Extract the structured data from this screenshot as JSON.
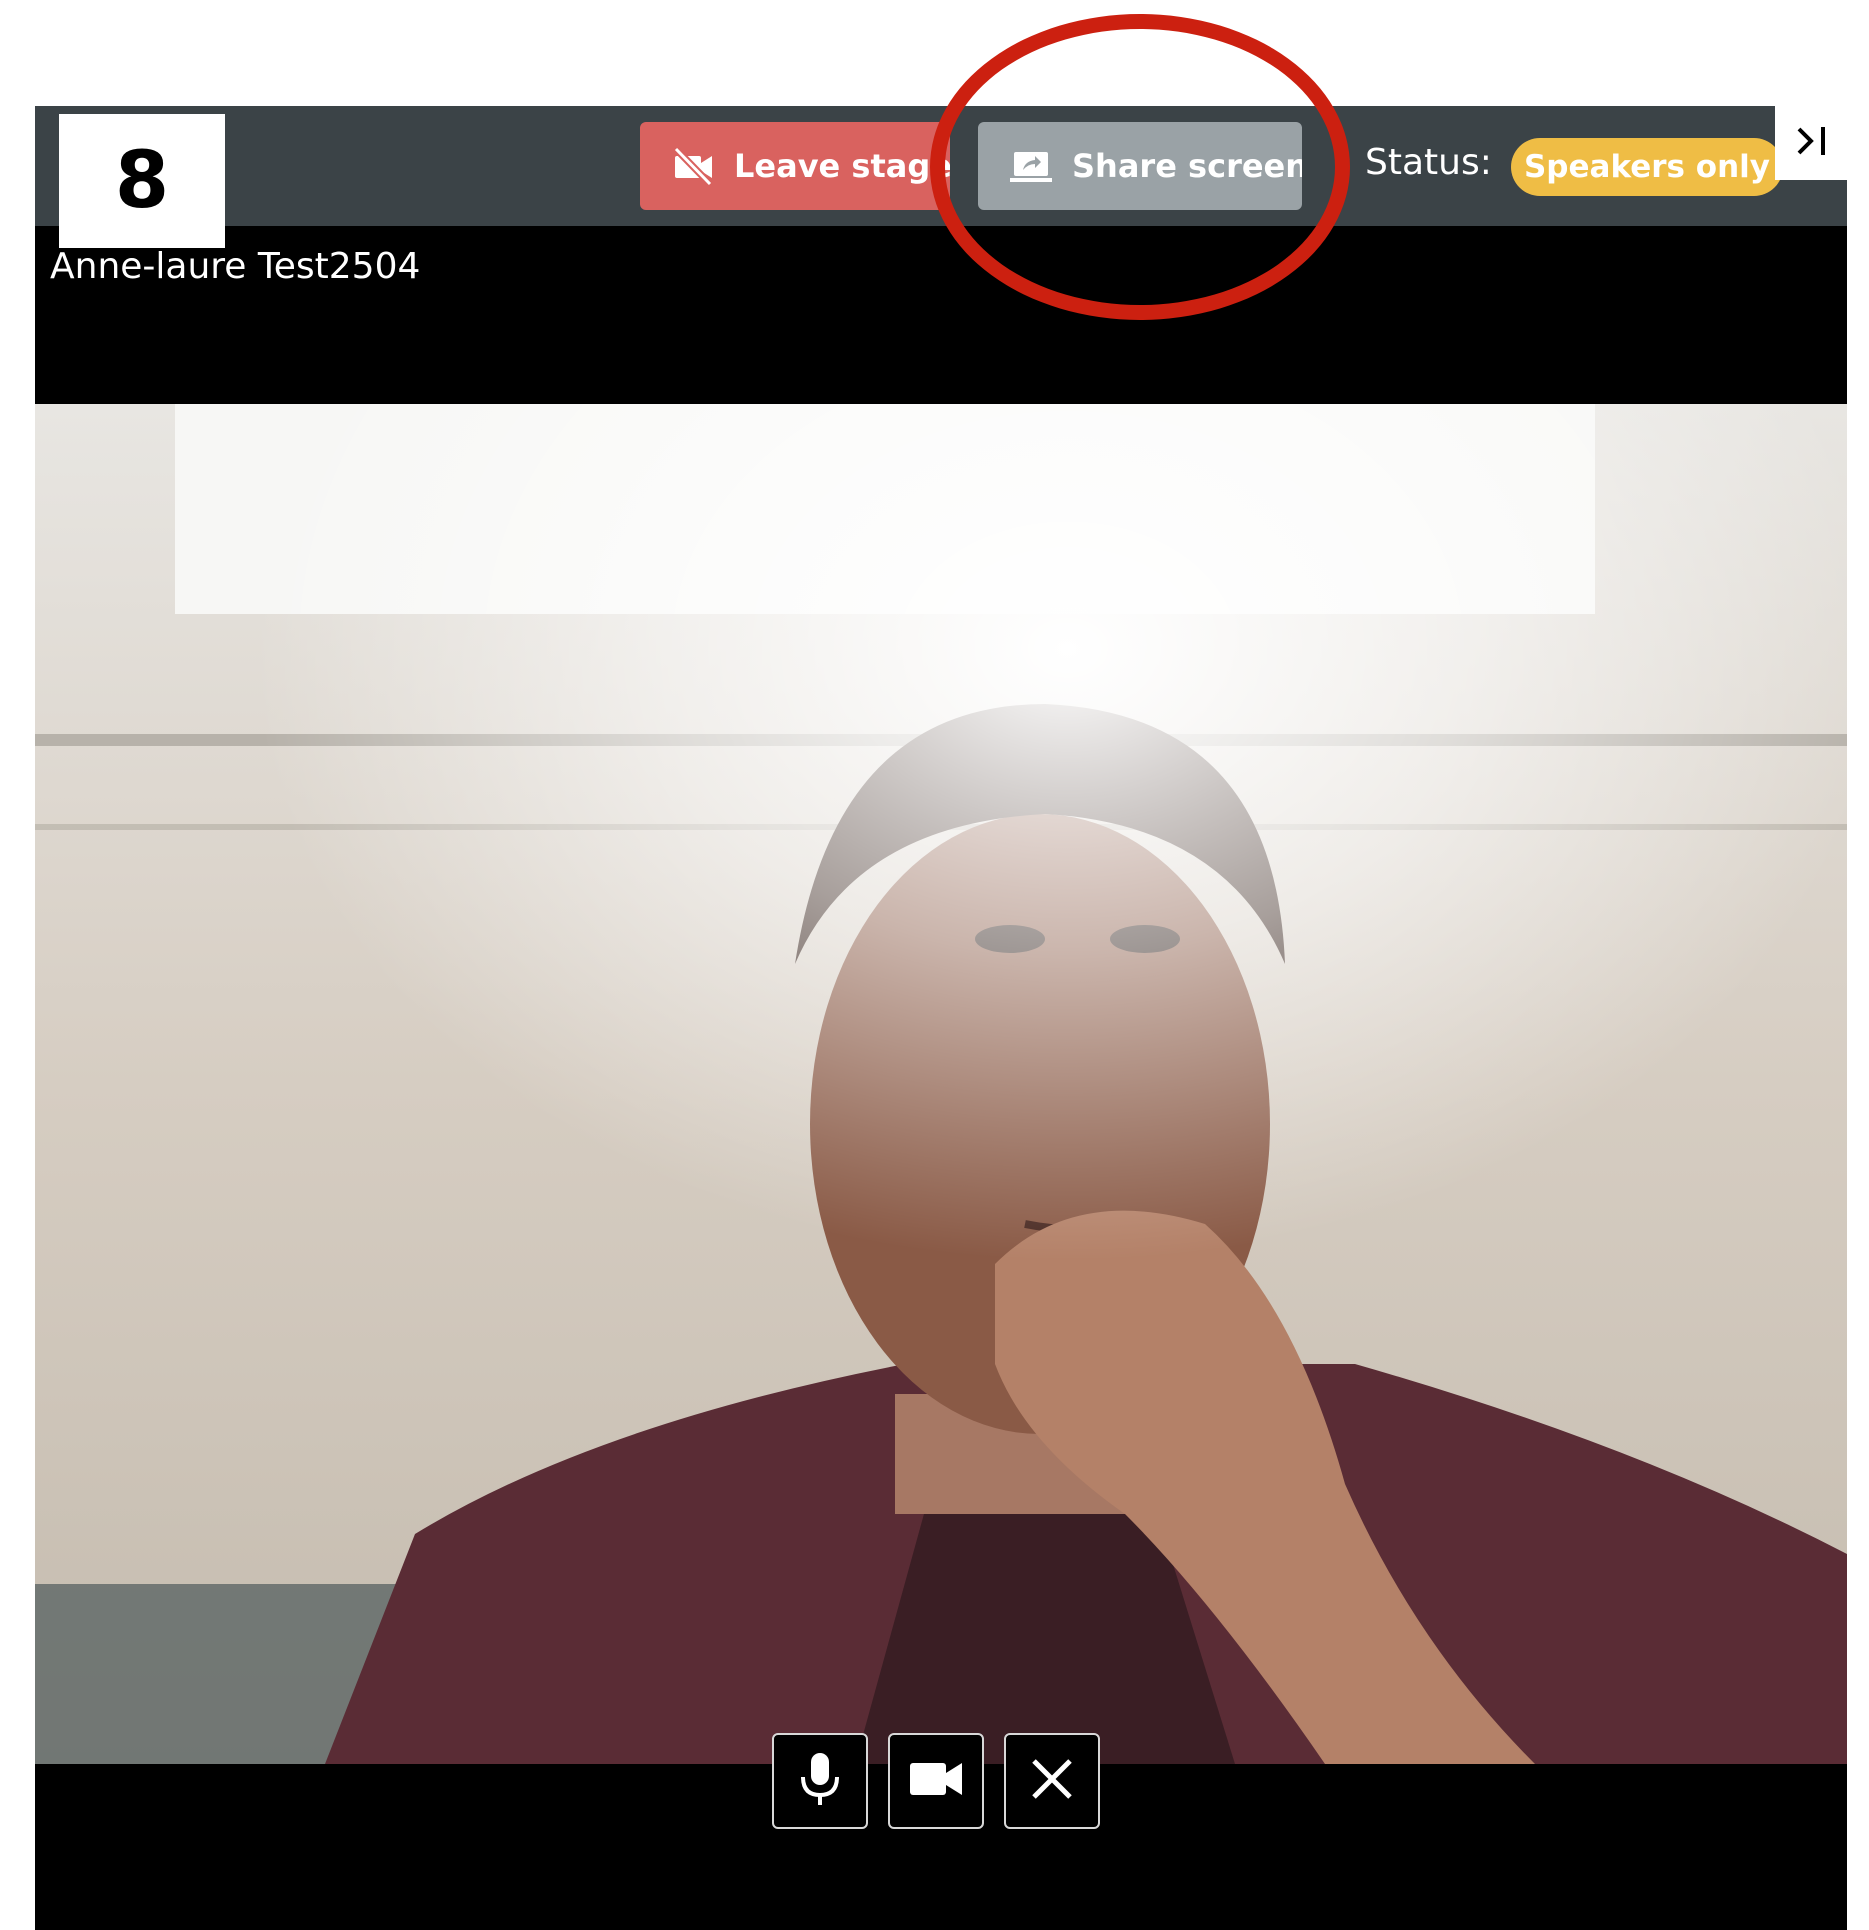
{
  "step": {
    "number": "8"
  },
  "toolbar": {
    "leave_label": "Leave stage",
    "share_label": "Share screen",
    "status_label": "Status:",
    "status_value": "Speakers only"
  },
  "participant": {
    "name": "Anne-laure Test2504"
  },
  "colors": {
    "toolbar_bg": "#3b4347",
    "leave_button": "#d9625f",
    "share_button": "#9aa2a6",
    "status_pill": "#efbd45",
    "annotation": "#cc2010"
  },
  "icons": {
    "leave": "video-off-icon",
    "share": "share-screen-icon",
    "collapse": "collapse-panel-icon",
    "mic": "microphone-icon",
    "camera": "camera-icon",
    "close": "close-icon"
  }
}
